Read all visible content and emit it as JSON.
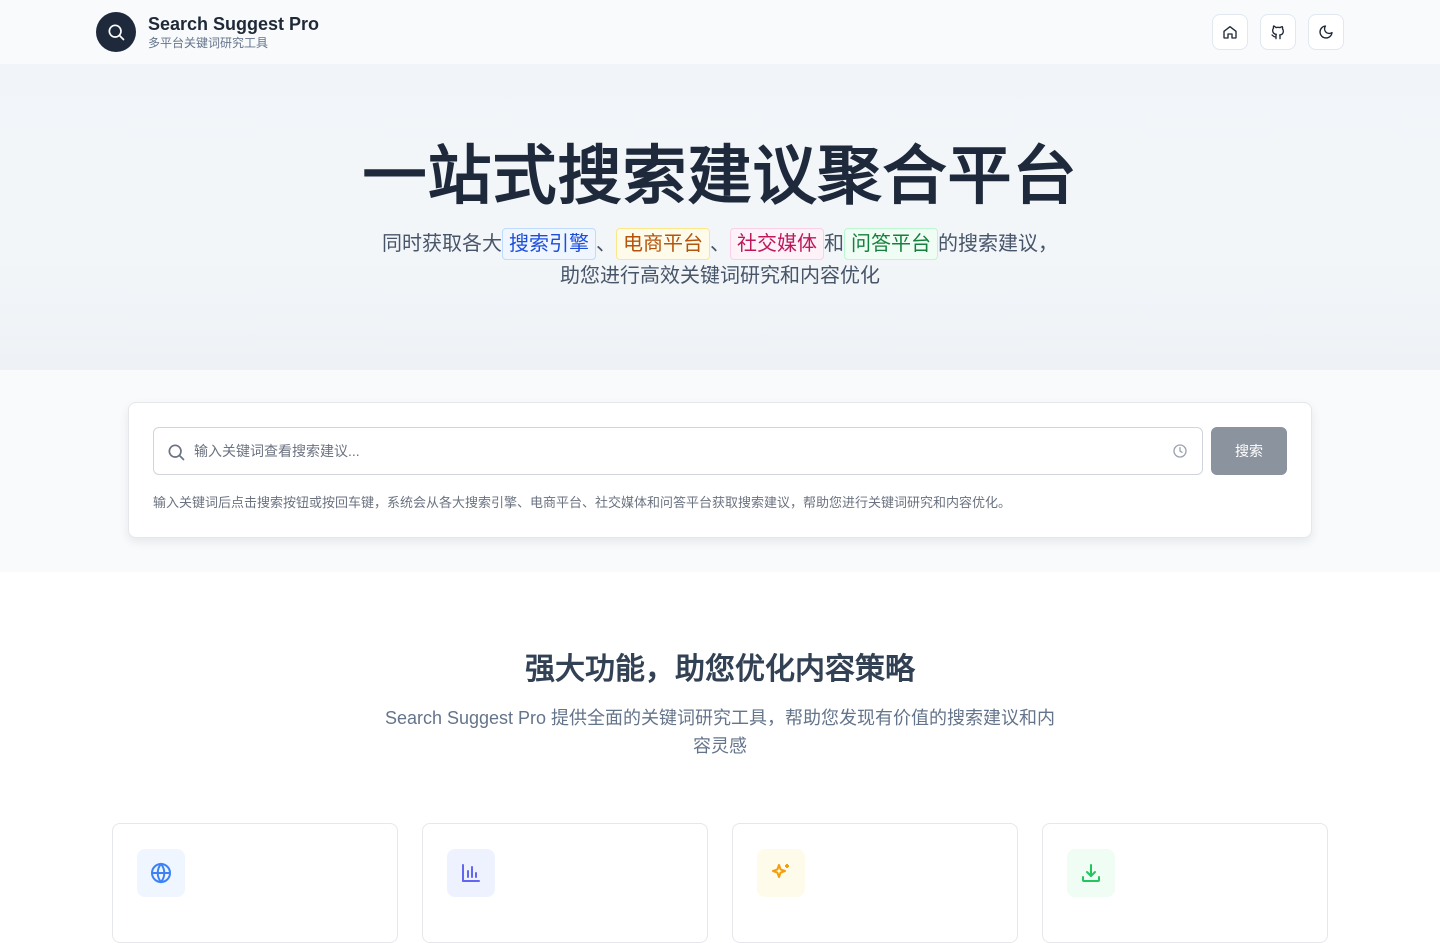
{
  "header": {
    "title": "Search Suggest Pro",
    "subtitle": "多平台关键词研究工具",
    "logo_icon": "search-icon",
    "actions": [
      {
        "name": "home-icon"
      },
      {
        "name": "github-icon"
      },
      {
        "name": "moon-icon"
      }
    ]
  },
  "hero": {
    "title": "一站式搜索建议聚合平台",
    "desc_prefix": "同时获取各大",
    "tags": [
      "搜索引擎",
      "电商平台",
      "社交媒体",
      "问答平台"
    ],
    "sep1": "、",
    "sep2": "、",
    "conj": "和",
    "desc_suffix": "的搜索建议，",
    "desc_line2": "助您进行高效关键词研究和内容优化"
  },
  "search": {
    "placeholder": "输入关键词查看搜索建议...",
    "button_label": "搜索",
    "hint": "输入关键词后点击搜索按钮或按回车键，系统会从各大搜索引擎、电商平台、社交媒体和问答平台获取搜索建议，帮助您进行关键词研究和内容优化。"
  },
  "features": {
    "title": "强大功能，助您优化内容策略",
    "desc": "Search Suggest Pro 提供全面的关键词研究工具，帮助您发现有价值的搜索建议和内容灵感",
    "cards": [
      {
        "icon": "globe-icon",
        "color": "#3b82f6",
        "bg": "#eff6ff"
      },
      {
        "icon": "bar-chart-icon",
        "color": "#6366f1",
        "bg": "#eef2ff"
      },
      {
        "icon": "sparkles-icon",
        "color": "#f59e0b",
        "bg": "#fffbeb"
      },
      {
        "icon": "download-icon",
        "color": "#22c55e",
        "bg": "#f0fdf4"
      }
    ]
  }
}
